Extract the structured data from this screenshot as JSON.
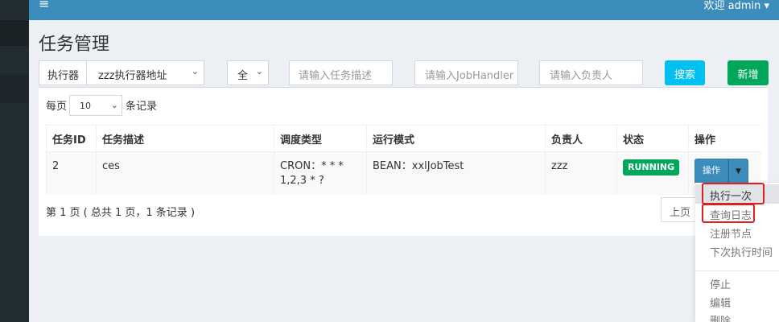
{
  "topbar": {
    "menu_icon": "hamburger-icon",
    "user_menu": "欢迎 admin ▾"
  },
  "page": {
    "title": "任务管理"
  },
  "filters": {
    "executor_label": "执行器",
    "executor_value": "zzz执行器地址",
    "status_value": "全",
    "desc_placeholder": "请输入任务描述",
    "handler_placeholder": "请输入JobHandler",
    "author_placeholder": "请输入负责人",
    "search_label": "搜索",
    "add_label": "新增"
  },
  "page_size": {
    "prefix": "每页",
    "value": "10",
    "suffix": "条记录"
  },
  "table": {
    "headers": [
      "任务ID",
      "任务描述",
      "调度类型",
      "运行模式",
      "负责人",
      "状态",
      "操作"
    ],
    "rows": [
      {
        "id": "2",
        "desc": "ces",
        "schedule_line1": "CRON：* * *",
        "schedule_line2": "1,2,3 * ?",
        "mode": "BEAN：xxlJobTest",
        "author": "zzz",
        "status": "RUNNING",
        "action": "操作"
      }
    ]
  },
  "pager": {
    "info": "第 1 页 ( 总共 1 页，1 条记录 )",
    "prev": "上页"
  },
  "dropdown": {
    "items": [
      "执行一次",
      "查询日志",
      "注册节点",
      "下次执行时间"
    ],
    "items2": [
      "停止",
      "编辑",
      "删除"
    ]
  },
  "colors": {
    "topbar": "#3c8dbc",
    "sidebar": "#222d32",
    "search": "#00c0ef",
    "add": "#00a65a",
    "highlight": "#e02020"
  }
}
